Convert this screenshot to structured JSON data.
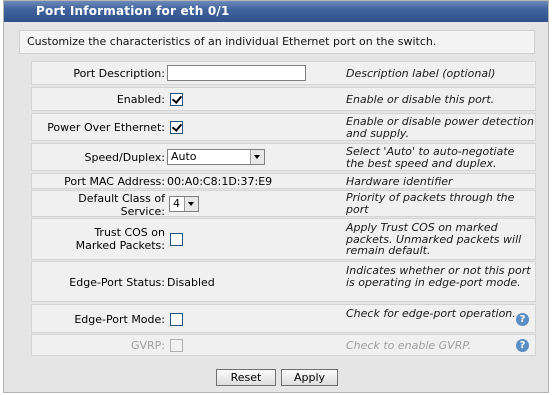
{
  "title": "Port Information for eth 0/1",
  "intro": "Customize the characteristics of an individual Ethernet port on the switch.",
  "fields": {
    "description": {
      "label": "Port Description:",
      "value": "",
      "help": "Description label (optional)"
    },
    "enabled": {
      "label": "Enabled:",
      "checked": true,
      "help": "Enable or disable this port."
    },
    "poe": {
      "label": "Power Over Ethernet:",
      "checked": true,
      "help": "Enable or disable power detection and supply."
    },
    "speed": {
      "label": "Speed/Duplex:",
      "value": "Auto",
      "help": "Select 'Auto' to auto-negotiate the best speed and duplex."
    },
    "mac": {
      "label": "Port MAC Address:",
      "value": "00:A0:C8:1D:37:E9",
      "help": "Hardware identifier"
    },
    "cos": {
      "label": "Default Class of Service:",
      "value": "4",
      "help": "Priority of packets through the port"
    },
    "trust_cos": {
      "label": "Trust COS on Marked Packets:",
      "checked": false,
      "help": "Apply Trust COS on marked packets. Unmarked packets will remain default."
    },
    "edge_status": {
      "label": "Edge-Port Status:",
      "value": "Disabled",
      "help": "Indicates whether or not this port is operating in edge-port mode."
    },
    "edge_mode": {
      "label": "Edge-Port Mode:",
      "checked": false,
      "help": "Check for edge-port operation."
    },
    "gvrp": {
      "label": "GVRP:",
      "checked": false,
      "help": "Check to enable GVRP."
    }
  },
  "help_icon": "question-mark-icon",
  "buttons": {
    "reset": "Reset",
    "apply": "Apply"
  },
  "colors": {
    "title_bar": "#41649e",
    "help_icon": "#5a8ec4"
  }
}
